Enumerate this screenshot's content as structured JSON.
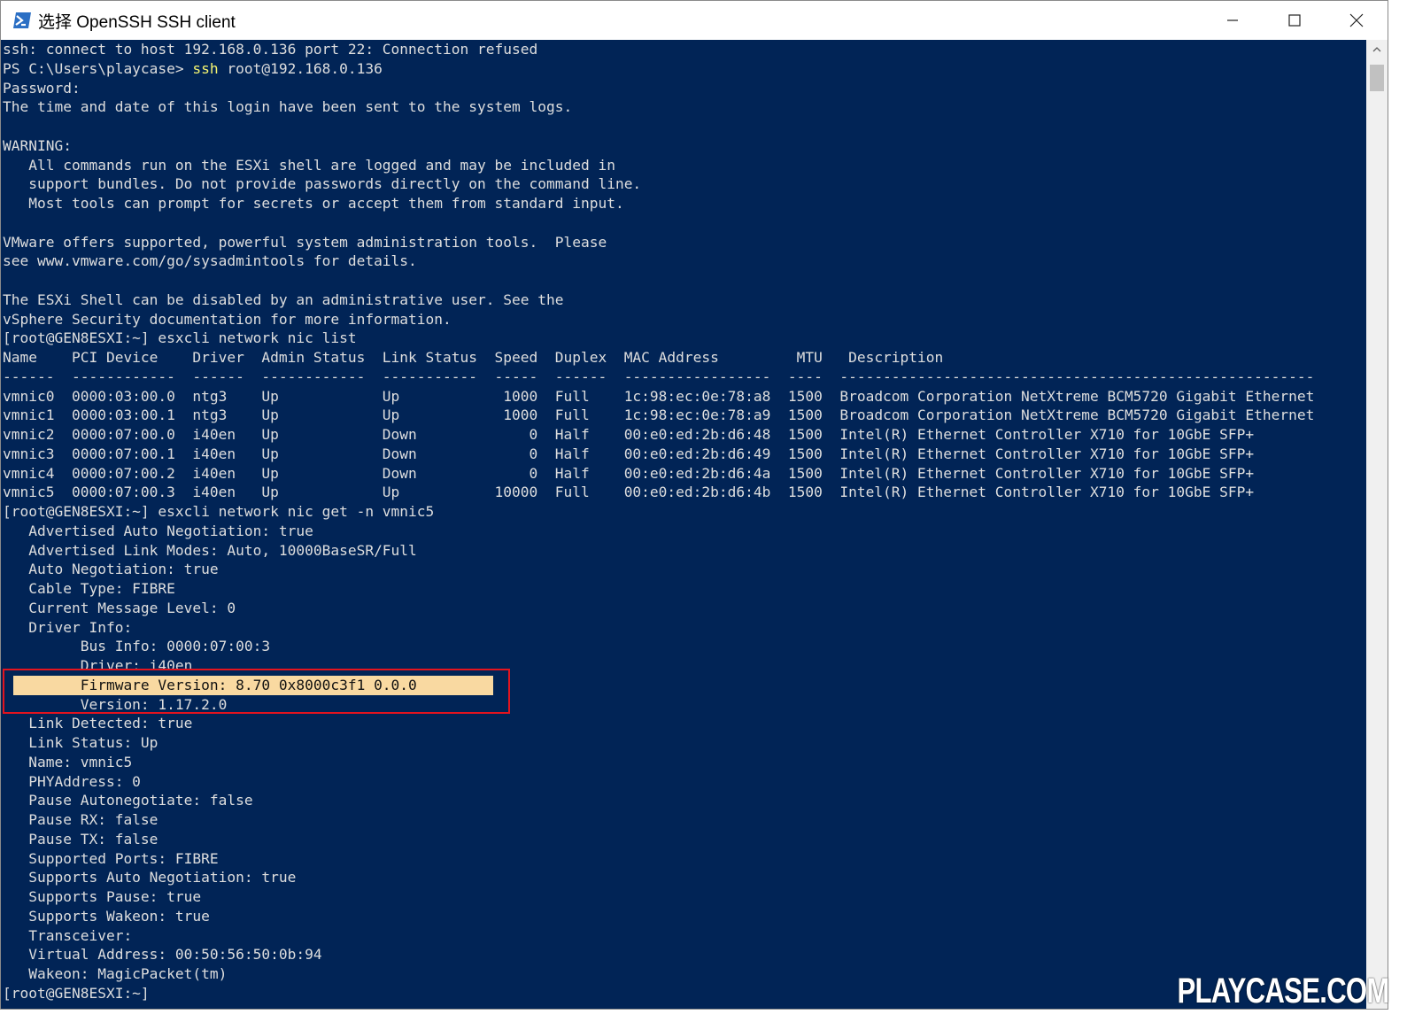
{
  "window": {
    "title": "选择 OpenSSH SSH client"
  },
  "colors": {
    "console_bg": "#012456",
    "console_text": "#dedede",
    "command": "#f5f571",
    "highlight": "#f9d9a1",
    "annotation_box": "#e3141e"
  },
  "icons": {
    "app": "powershell-icon",
    "minimize": "minimize-icon",
    "maximize": "maximize-icon",
    "close": "close-icon",
    "scroll_up": "chevron-up-icon"
  },
  "console": {
    "l1": "ssh: connect to host 192.168.0.136 port 22: Connection refused",
    "l2_prompt": "PS C:\\Users\\playcase> ",
    "l2_cmd": "ssh",
    "l2_args": " root@192.168.0.136",
    "l3": "Password:",
    "l4": "The time and date of this login have been sent to the system logs.",
    "l5": "",
    "l6": "WARNING:",
    "l7": "   All commands run on the ESXi shell are logged and may be included in",
    "l8": "   support bundles. Do not provide passwords directly on the command line.",
    "l9": "   Most tools can prompt for secrets or accept them from standard input.",
    "l10": "",
    "l11": "VMware offers supported, powerful system administration tools.  Please",
    "l12": "see www.vmware.com/go/sysadmintools for details.",
    "l13": "",
    "l14": "The ESXi Shell can be disabled by an administrative user. See the",
    "l15": "vSphere Security documentation for more information.",
    "l16": "[root@GEN8ESXI:~] esxcli network nic list",
    "l17": "Name    PCI Device    Driver  Admin Status  Link Status  Speed  Duplex  MAC Address         MTU   Description",
    "l18": "------  ------------  ------  ------------  -----------  -----  ------  -----------------  ----  -------------------------------------------------------",
    "l19": "vmnic0  0000:03:00.0  ntg3    Up            Up            1000  Full    1c:98:ec:0e:78:a8  1500  Broadcom Corporation NetXtreme BCM5720 Gigabit Ethernet",
    "l20": "vmnic1  0000:03:00.1  ntg3    Up            Up            1000  Full    1c:98:ec:0e:78:a9  1500  Broadcom Corporation NetXtreme BCM5720 Gigabit Ethernet",
    "l21": "vmnic2  0000:07:00.0  i40en   Up            Down             0  Half    00:e0:ed:2b:d6:48  1500  Intel(R) Ethernet Controller X710 for 10GbE SFP+",
    "l22": "vmnic3  0000:07:00.1  i40en   Up            Down             0  Half    00:e0:ed:2b:d6:49  1500  Intel(R) Ethernet Controller X710 for 10GbE SFP+",
    "l23": "vmnic4  0000:07:00.2  i40en   Up            Down             0  Half    00:e0:ed:2b:d6:4a  1500  Intel(R) Ethernet Controller X710 for 10GbE SFP+",
    "l24": "vmnic5  0000:07:00.3  i40en   Up            Up           10000  Full    00:e0:ed:2b:d6:4b  1500  Intel(R) Ethernet Controller X710 for 10GbE SFP+",
    "l25": "[root@GEN8ESXI:~] esxcli network nic get -n vmnic5",
    "l26": "   Advertised Auto Negotiation: true",
    "l27": "   Advertised Link Modes: Auto, 10000BaseSR/Full",
    "l28": "   Auto Negotiation: true",
    "l29": "   Cable Type: FIBRE",
    "l30": "   Current Message Level: 0",
    "l31": "   Driver Info:",
    "l32": "         Bus Info: 0000:07:00:3",
    "l33": "         Driver: i40en",
    "l34": "         Firmware Version: 8.70 0x8000c3f1 0.0.0",
    "l35": "         Version: 1.17.2.0",
    "l36": "   Link Detected: true",
    "l37": "   Link Status: Up",
    "l38": "   Name: vmnic5",
    "l39": "   PHYAddress: 0",
    "l40": "   Pause Autonegotiate: false",
    "l41": "   Pause RX: false",
    "l42": "   Pause TX: false",
    "l43": "   Supported Ports: FIBRE",
    "l44": "   Supports Auto Negotiation: true",
    "l45": "   Supports Pause: true",
    "l46": "   Supports Wakeon: true",
    "l47": "   Transceiver:",
    "l48": "   Virtual Address: 00:50:56:50:0b:94",
    "l49": "   Wakeon: MagicPacket(tm)",
    "l50": "[root@GEN8ESXI:~] "
  },
  "watermark": "PLAYCASE.COM"
}
